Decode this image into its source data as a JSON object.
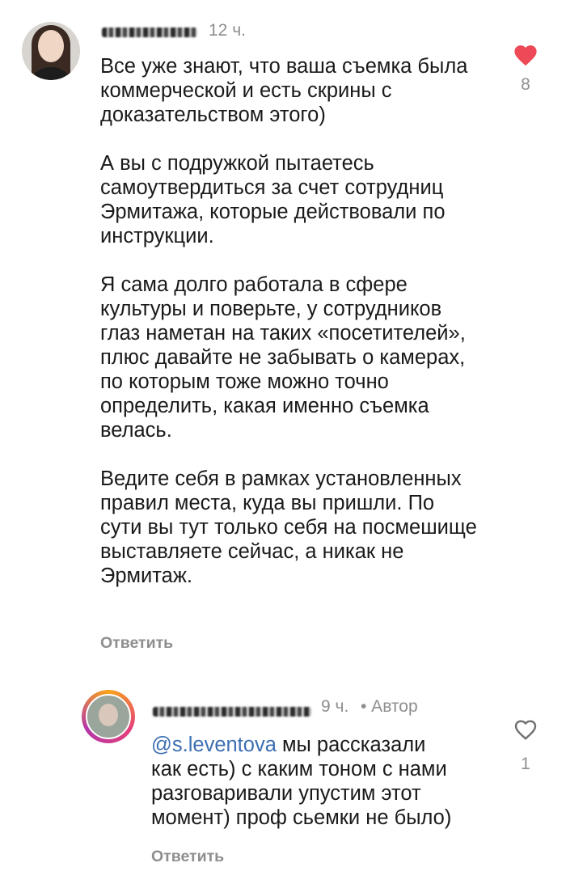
{
  "comments": [
    {
      "time": "12 ч.",
      "paragraphs": [
        "Все уже знают, что ваша съемка была коммерческой и есть скрины с доказательством этого)",
        "А вы с подружкой пытаетесь самоутвердиться за счет сотрудниц Эрмитажа, которые действовали по инструкции.",
        "Я сама долго работала в сфере культуры и поверьте, у сотрудников глаз наметан на таких «посетителей», плюс давайте не забывать о камерах, по которым тоже можно точно определить, какая именно съемка велась.",
        "Ведите себя в рамках установленных правил места, куда вы пришли. По сути вы тут только себя на посмешище выставляете сейчас, а никак не Эрмитаж."
      ],
      "reply_label": "Ответить",
      "likes": "8",
      "liked": true
    },
    {
      "time": "9 ч.",
      "author_badge": "• Автор",
      "mention": "@s.leventova",
      "text": " мы рассказали как есть) с каким тоном с нами разговаривали упустим этот момент) проф сьемки не было)",
      "reply_label": "Ответить",
      "likes": "1",
      "liked": false
    }
  ],
  "colors": {
    "heart_liked": "#ed4956",
    "mention": "#3d6fb3",
    "meta": "#8e8e8e"
  },
  "icons": [
    "heart-filled-icon",
    "heart-outline-icon"
  ]
}
